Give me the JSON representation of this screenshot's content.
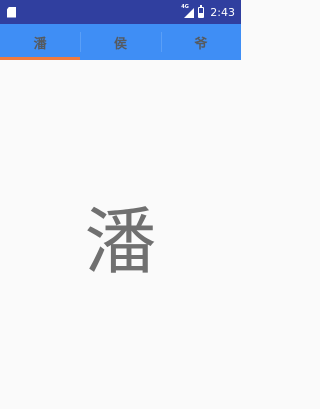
{
  "status_bar": {
    "time": "2:43",
    "network": "4G",
    "icons": [
      "sd-card-icon",
      "signal-icon",
      "battery-icon"
    ]
  },
  "tabs": [
    {
      "label": "潘",
      "selected": true
    },
    {
      "label": "侯",
      "selected": false
    },
    {
      "label": "爷",
      "selected": false
    }
  ],
  "content": {
    "text": "潘"
  },
  "colors": {
    "status_bar": "#303f9f",
    "tab_bar": "#3f8ef5",
    "indicator": "#f07a3e",
    "background": "#fafafa",
    "tab_text": "#555a60",
    "content_text": "#707070"
  }
}
